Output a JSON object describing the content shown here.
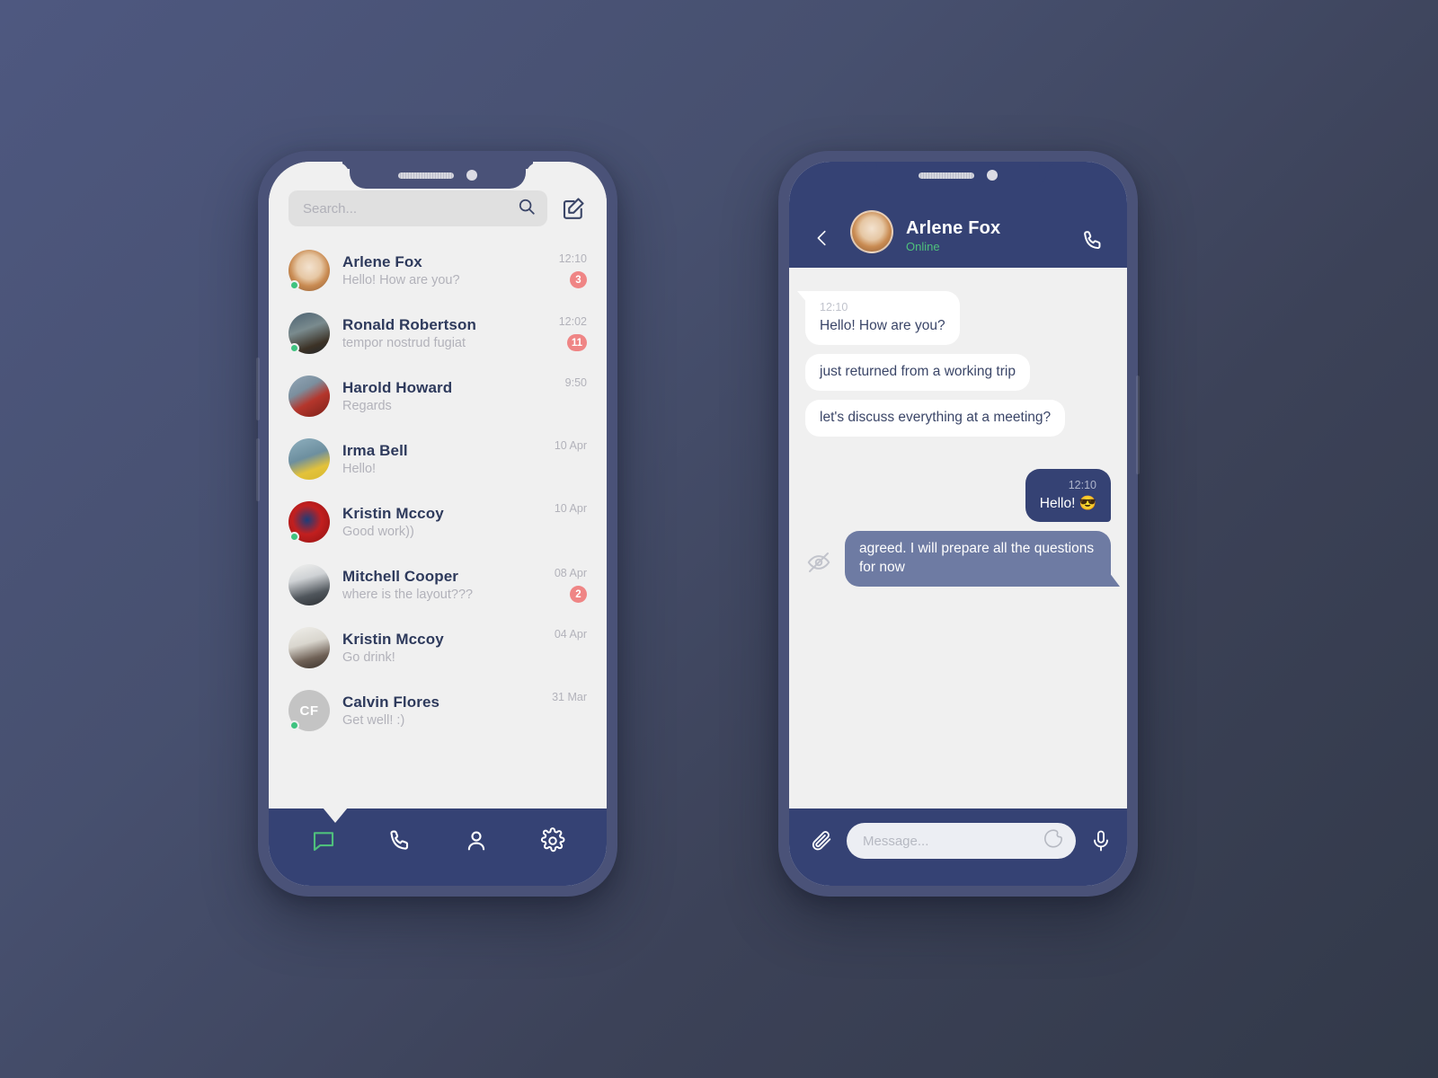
{
  "theme": {
    "background_gradient_from": "#4e5880",
    "background_gradient_to": "#323949",
    "phone_frame": "#4a5278",
    "screen_bg": "#f0f0f0",
    "accent_navy": "#354274",
    "accent_light_navy": "#6e7ba3",
    "online_green": "#3fc380",
    "badge_red": "#ef8585",
    "name_text": "#2e3a5c",
    "muted_text": "#b2b2ba"
  },
  "chat_list_phone": {
    "search": {
      "placeholder": "Search...",
      "value": "",
      "search_icon": "search-icon"
    },
    "compose_icon": "compose-pencil-icon",
    "items": [
      {
        "name": "Arlene Fox",
        "message": "Hello! How are you?",
        "time": "12:10",
        "badge": "3",
        "online": true,
        "avatar_style": "ph1",
        "initials": ""
      },
      {
        "name": "Ronald Robertson",
        "message": "tempor nostrud fugiat",
        "time": "12:02",
        "badge": "11",
        "online": true,
        "avatar_style": "ph2",
        "initials": ""
      },
      {
        "name": "Harold Howard",
        "message": "Regards",
        "time": "9:50",
        "badge": "",
        "online": false,
        "avatar_style": "ph3",
        "initials": ""
      },
      {
        "name": "Irma Bell",
        "message": "Hello!",
        "time": "10 Apr",
        "badge": "",
        "online": false,
        "avatar_style": "ph4",
        "initials": ""
      },
      {
        "name": "Kristin Mccoy",
        "message": "Good work))",
        "time": "10 Apr",
        "badge": "",
        "online": true,
        "avatar_style": "ph5",
        "initials": ""
      },
      {
        "name": "Mitchell Cooper",
        "message": "where is the layout???",
        "time": "08 Apr",
        "badge": "2",
        "online": false,
        "avatar_style": "ph6",
        "initials": ""
      },
      {
        "name": "Kristin Mccoy",
        "message": "Go drink!",
        "time": "04 Apr",
        "badge": "",
        "online": false,
        "avatar_style": "ph7",
        "initials": ""
      },
      {
        "name": "Calvin Flores",
        "message": "Get well! :)",
        "time": "31 Mar",
        "badge": "",
        "online": true,
        "avatar_style": "ph-init",
        "initials": "CF"
      }
    ],
    "tabbar": {
      "active_index": 0,
      "tabs": [
        {
          "icon": "chat-bubble-icon",
          "label": "Chats"
        },
        {
          "icon": "phone-icon",
          "label": "Calls"
        },
        {
          "icon": "person-icon",
          "label": "Contacts"
        },
        {
          "icon": "gear-icon",
          "label": "Settings"
        }
      ]
    }
  },
  "conversation_phone": {
    "header": {
      "back_icon": "chevron-left-icon",
      "contact_name": "Arlene Fox",
      "status": "Online",
      "call_icon": "phone-icon"
    },
    "messages": [
      {
        "side": "in",
        "time": "12:10",
        "text": "Hello! How are you?",
        "tail": true,
        "style": "white"
      },
      {
        "side": "in",
        "time": "",
        "text": "just returned from a working trip",
        "tail": false,
        "style": "white"
      },
      {
        "side": "in",
        "time": "",
        "text": "let's discuss everything at a meeting?",
        "tail": false,
        "style": "white"
      },
      {
        "side": "out",
        "time": "12:10",
        "text": "Hello! 😎",
        "tail": false,
        "style": "dark"
      },
      {
        "side": "out",
        "time": "",
        "text": "agreed. I will prepare all the questions for now",
        "tail": true,
        "style": "light",
        "unread_icon": "eye-slash-icon"
      }
    ],
    "composer": {
      "attach_icon": "paperclip-icon",
      "placeholder": "Message...",
      "value": "",
      "emoji_icon": "smiley-icon",
      "mic_icon": "microphone-icon"
    }
  }
}
